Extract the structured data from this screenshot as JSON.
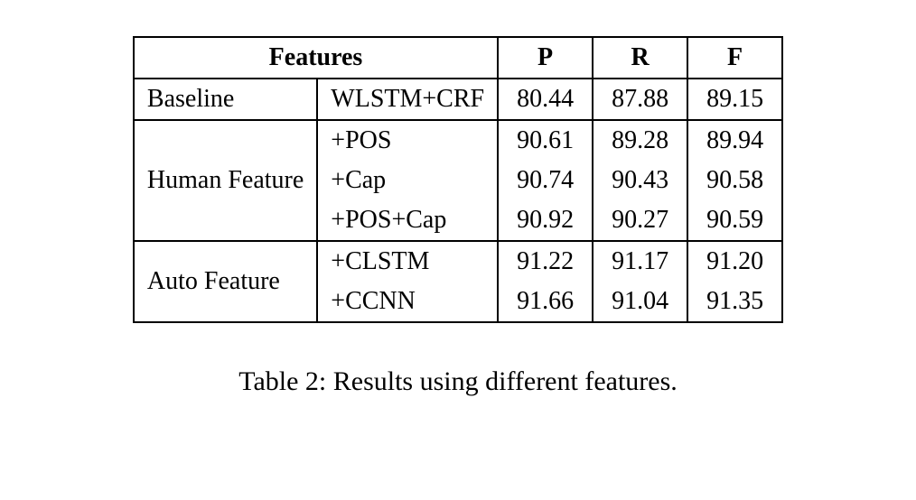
{
  "chart_data": {
    "type": "table",
    "title": "Table 2: Results using different features.",
    "columns": [
      "Features (group)",
      "Features (method)",
      "P",
      "R",
      "F"
    ],
    "rows": [
      {
        "group": "Baseline",
        "method": "WLSTM+CRF",
        "P": 80.44,
        "R": 87.88,
        "F": 89.15
      },
      {
        "group": "Human Feature",
        "method": "+POS",
        "P": 90.61,
        "R": 89.28,
        "F": 89.94
      },
      {
        "group": "Human Feature",
        "method": "+Cap",
        "P": 90.74,
        "R": 90.43,
        "F": 90.58
      },
      {
        "group": "Human Feature",
        "method": "+POS+Cap",
        "P": 90.92,
        "R": 90.27,
        "F": 90.59
      },
      {
        "group": "Auto Feature",
        "method": "+CLSTM",
        "P": 91.22,
        "R": 91.17,
        "F": 91.2
      },
      {
        "group": "Auto Feature",
        "method": "+CCNN",
        "P": 91.66,
        "R": 91.04,
        "F": 91.35
      }
    ]
  },
  "table": {
    "headers": {
      "features": "Features",
      "p": "P",
      "r": "R",
      "f": "F"
    },
    "groups": [
      {
        "label": "Baseline",
        "rows": [
          {
            "method": "WLSTM+CRF",
            "p": "80.44",
            "r": "87.88",
            "f": "89.15"
          }
        ]
      },
      {
        "label": "Human Feature",
        "rows": [
          {
            "method": "+POS",
            "p": "90.61",
            "r": "89.28",
            "f": "89.94"
          },
          {
            "method": "+Cap",
            "p": "90.74",
            "r": "90.43",
            "f": "90.58"
          },
          {
            "method": "+POS+Cap",
            "p": "90.92",
            "r": "90.27",
            "f": "90.59"
          }
        ]
      },
      {
        "label": "Auto Feature",
        "rows": [
          {
            "method": "+CLSTM",
            "p": "91.22",
            "r": "91.17",
            "f": "91.20"
          },
          {
            "method": "+CCNN",
            "p": "91.66",
            "r": "91.04",
            "f": "91.35"
          }
        ]
      }
    ]
  },
  "caption": "Table 2: Results using different features."
}
